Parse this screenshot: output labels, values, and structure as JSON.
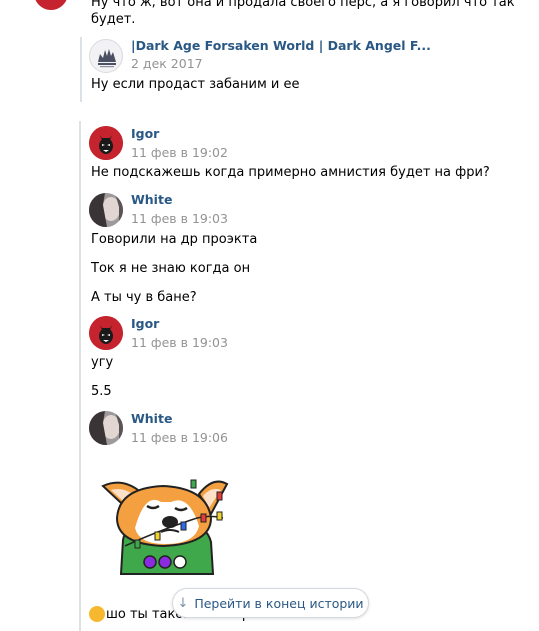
{
  "top_message": {
    "line1": "Ну что ж, вот она и продала своего перс, а я говорил что так",
    "line2": "будет.",
    "quote": {
      "source": "|Dark Age Forsaken World | Dark Angel F...",
      "date": "2 дек 2017",
      "text": "Ну если продаст забаним и ее"
    }
  },
  "messages": [
    {
      "author": "Igor",
      "time": "11 фев в 19:02",
      "texts": [
        "Не подскажешь когда примерно амнистия будет на фри?"
      ]
    },
    {
      "author": "White",
      "time": "11 фев в 19:03",
      "texts": [
        "Говорили на др проэкта",
        "Ток я не знаю когда он",
        "А ты чу в бане?"
      ]
    },
    {
      "author": "Igor",
      "time": "11 фев в 19:03",
      "texts": [
        "угу",
        "5.5"
      ]
    },
    {
      "author": "White",
      "time": "11 фев в 19:06",
      "texts": []
    }
  ],
  "bottom_partial_text": "шо ты такого натворил",
  "scroll_button": {
    "icon": "arrow-down-icon",
    "label": "Перейти в конец истории"
  },
  "colors": {
    "link": "#2a5885",
    "meta": "#939393",
    "thread": "#dce1e6"
  }
}
